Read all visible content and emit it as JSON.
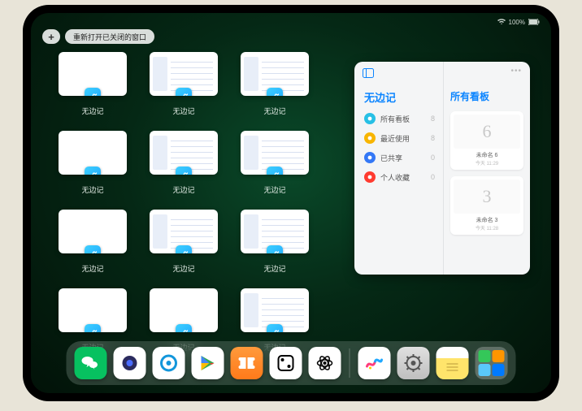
{
  "status": {
    "time": "",
    "battery": "100%"
  },
  "pill": {
    "plus": "+",
    "reopen": "重新打开已关闭的窗口"
  },
  "window_label": "无边记",
  "windows": [
    {
      "style": "blank"
    },
    {
      "style": "cal"
    },
    {
      "style": "cal"
    },
    {
      "style": "blank"
    },
    {
      "style": "cal"
    },
    {
      "style": "cal"
    },
    {
      "style": "blank"
    },
    {
      "style": "cal"
    },
    {
      "style": "cal"
    },
    {
      "style": "blank"
    },
    {
      "style": "blank"
    },
    {
      "style": "cal"
    }
  ],
  "panel": {
    "left_title": "无边记",
    "right_title": "所有看板",
    "categories": [
      {
        "label": "所有看板",
        "count": "8",
        "color": "#27c0e5"
      },
      {
        "label": "最近使用",
        "count": "8",
        "color": "#f8b500"
      },
      {
        "label": "已共享",
        "count": "0",
        "color": "#3478f6"
      },
      {
        "label": "个人收藏",
        "count": "0",
        "color": "#ff3b30"
      }
    ],
    "boards": [
      {
        "glyph": "6",
        "name": "未命名 6",
        "date": "今天 11:29"
      },
      {
        "glyph": "3",
        "name": "未命名 3",
        "date": "今天 11:28"
      }
    ]
  },
  "dock": [
    {
      "name": "wechat"
    },
    {
      "name": "quark"
    },
    {
      "name": "qqbrowser"
    },
    {
      "name": "play"
    },
    {
      "name": "books"
    },
    {
      "name": "dice"
    },
    {
      "name": "atom"
    },
    {
      "name": "sep"
    },
    {
      "name": "freeform"
    },
    {
      "name": "settings"
    },
    {
      "name": "notes"
    },
    {
      "name": "recent-folder"
    }
  ],
  "colors": {
    "accent": "#0a84ff"
  }
}
